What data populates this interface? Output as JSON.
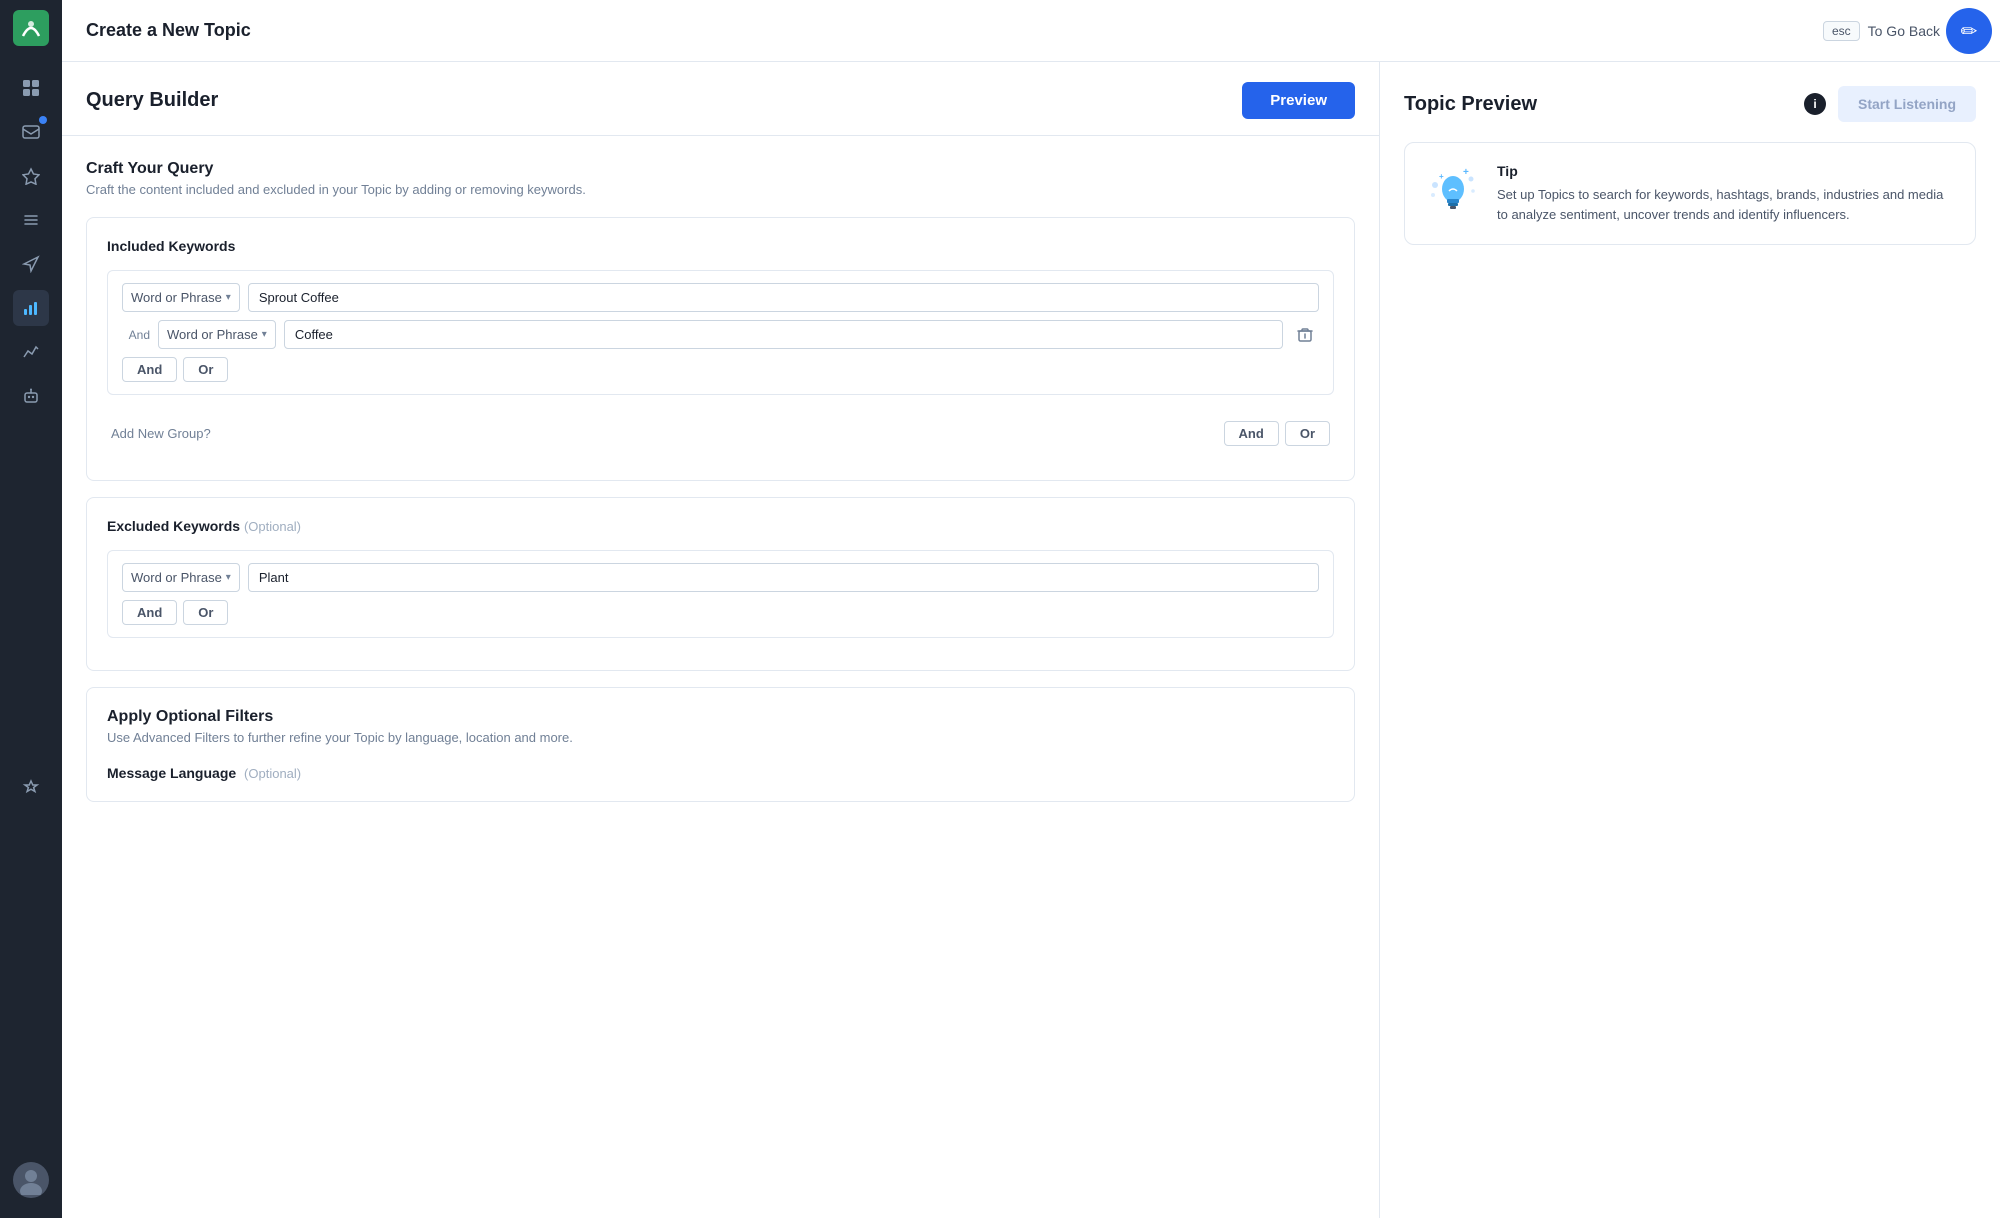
{
  "sidebar": {
    "items": [
      {
        "name": "logo",
        "icon": "🌱",
        "active": false
      },
      {
        "name": "dashboard",
        "icon": "⊞",
        "active": false
      },
      {
        "name": "inbox",
        "icon": "✉",
        "active": false
      },
      {
        "name": "pin",
        "icon": "📌",
        "active": false
      },
      {
        "name": "list",
        "icon": "≡",
        "active": false
      },
      {
        "name": "send",
        "icon": "➤",
        "active": false
      },
      {
        "name": "analytics",
        "icon": "📊",
        "active": true
      },
      {
        "name": "bar-chart",
        "icon": "📈",
        "active": false
      },
      {
        "name": "bot",
        "icon": "🤖",
        "active": false
      },
      {
        "name": "star",
        "icon": "☆",
        "active": false
      }
    ],
    "notification_badge": true,
    "help_icon": "?"
  },
  "header": {
    "title": "Create a New Topic",
    "esc_label": "esc",
    "to_go_back": "To Go Back",
    "close_label": "×"
  },
  "left_panel": {
    "title": "Query Builder",
    "preview_button": "Preview",
    "craft_query": {
      "title": "Craft Your Query",
      "description": "Craft the content included and excluded in your Topic by adding or removing keywords.",
      "included_keywords": {
        "label": "Included Keywords",
        "groups": [
          {
            "rows": [
              {
                "type": "Word or Phrase",
                "value": "Sprout Coffee",
                "show_delete": false
              },
              {
                "and_label": "And",
                "type": "Word or Phrase",
                "value": "Coffee",
                "show_delete": true
              }
            ],
            "and_label": "And",
            "or_label": "Or"
          }
        ],
        "add_new_group_label": "Add New Group?",
        "add_group_and": "And",
        "add_group_or": "Or"
      },
      "excluded_keywords": {
        "label": "Excluded Keywords",
        "optional_label": "(Optional)",
        "groups": [
          {
            "rows": [
              {
                "type": "Word or Phrase",
                "value": "Plant",
                "show_delete": false
              }
            ],
            "and_label": "And",
            "or_label": "Or"
          }
        ]
      }
    },
    "optional_filters": {
      "title": "Apply Optional Filters",
      "description": "Use Advanced Filters to further refine your Topic by language, location and more.",
      "message_language": {
        "label": "Message Language",
        "optional_label": "(Optional)"
      }
    }
  },
  "right_panel": {
    "title": "Topic Preview",
    "start_listening_button": "Start Listening",
    "tip": {
      "title": "Tip",
      "description": "Set up Topics to search for keywords, hashtags, brands, industries and media to analyze sentiment, uncover trends and identify influencers."
    }
  },
  "top_user_button": "✏"
}
